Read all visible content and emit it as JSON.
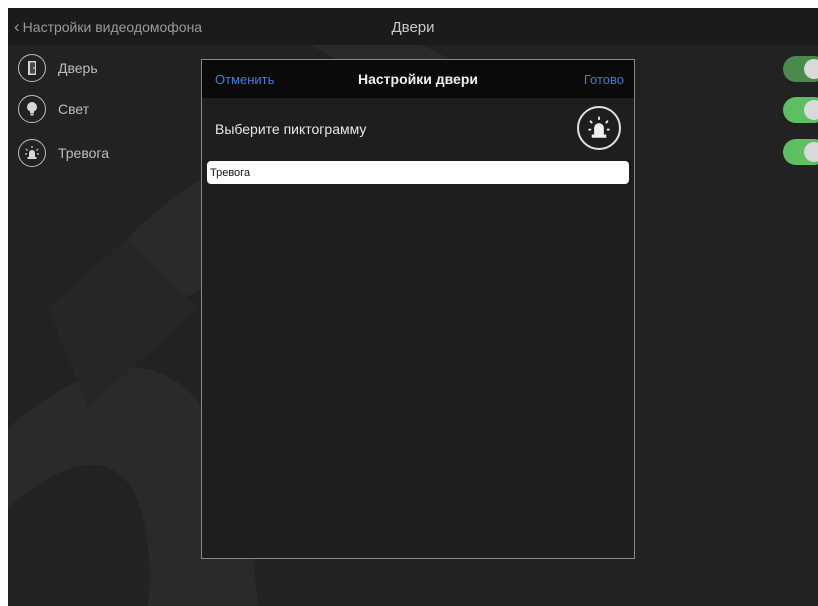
{
  "nav": {
    "back_label": "Настройки видеодомофона",
    "title": "Двери"
  },
  "devices": [
    {
      "label": "Дверь",
      "icon": "door-icon",
      "toggle_on": false
    },
    {
      "label": "Свет",
      "icon": "lightbulb-icon",
      "toggle_on": true
    },
    {
      "label": "Тревога",
      "icon": "alarm-siren-icon",
      "toggle_on": true
    }
  ],
  "modal": {
    "cancel_label": "Отменить",
    "title": "Настройки двери",
    "done_label": "Готово",
    "pick_label": "Выберите пиктограмму",
    "selected_icon": "alarm-siren-icon",
    "name_value": "Тревога"
  },
  "colors": {
    "background": "#222222",
    "accent": "#3f7fe0",
    "toggle_on": "#5cbf62"
  }
}
